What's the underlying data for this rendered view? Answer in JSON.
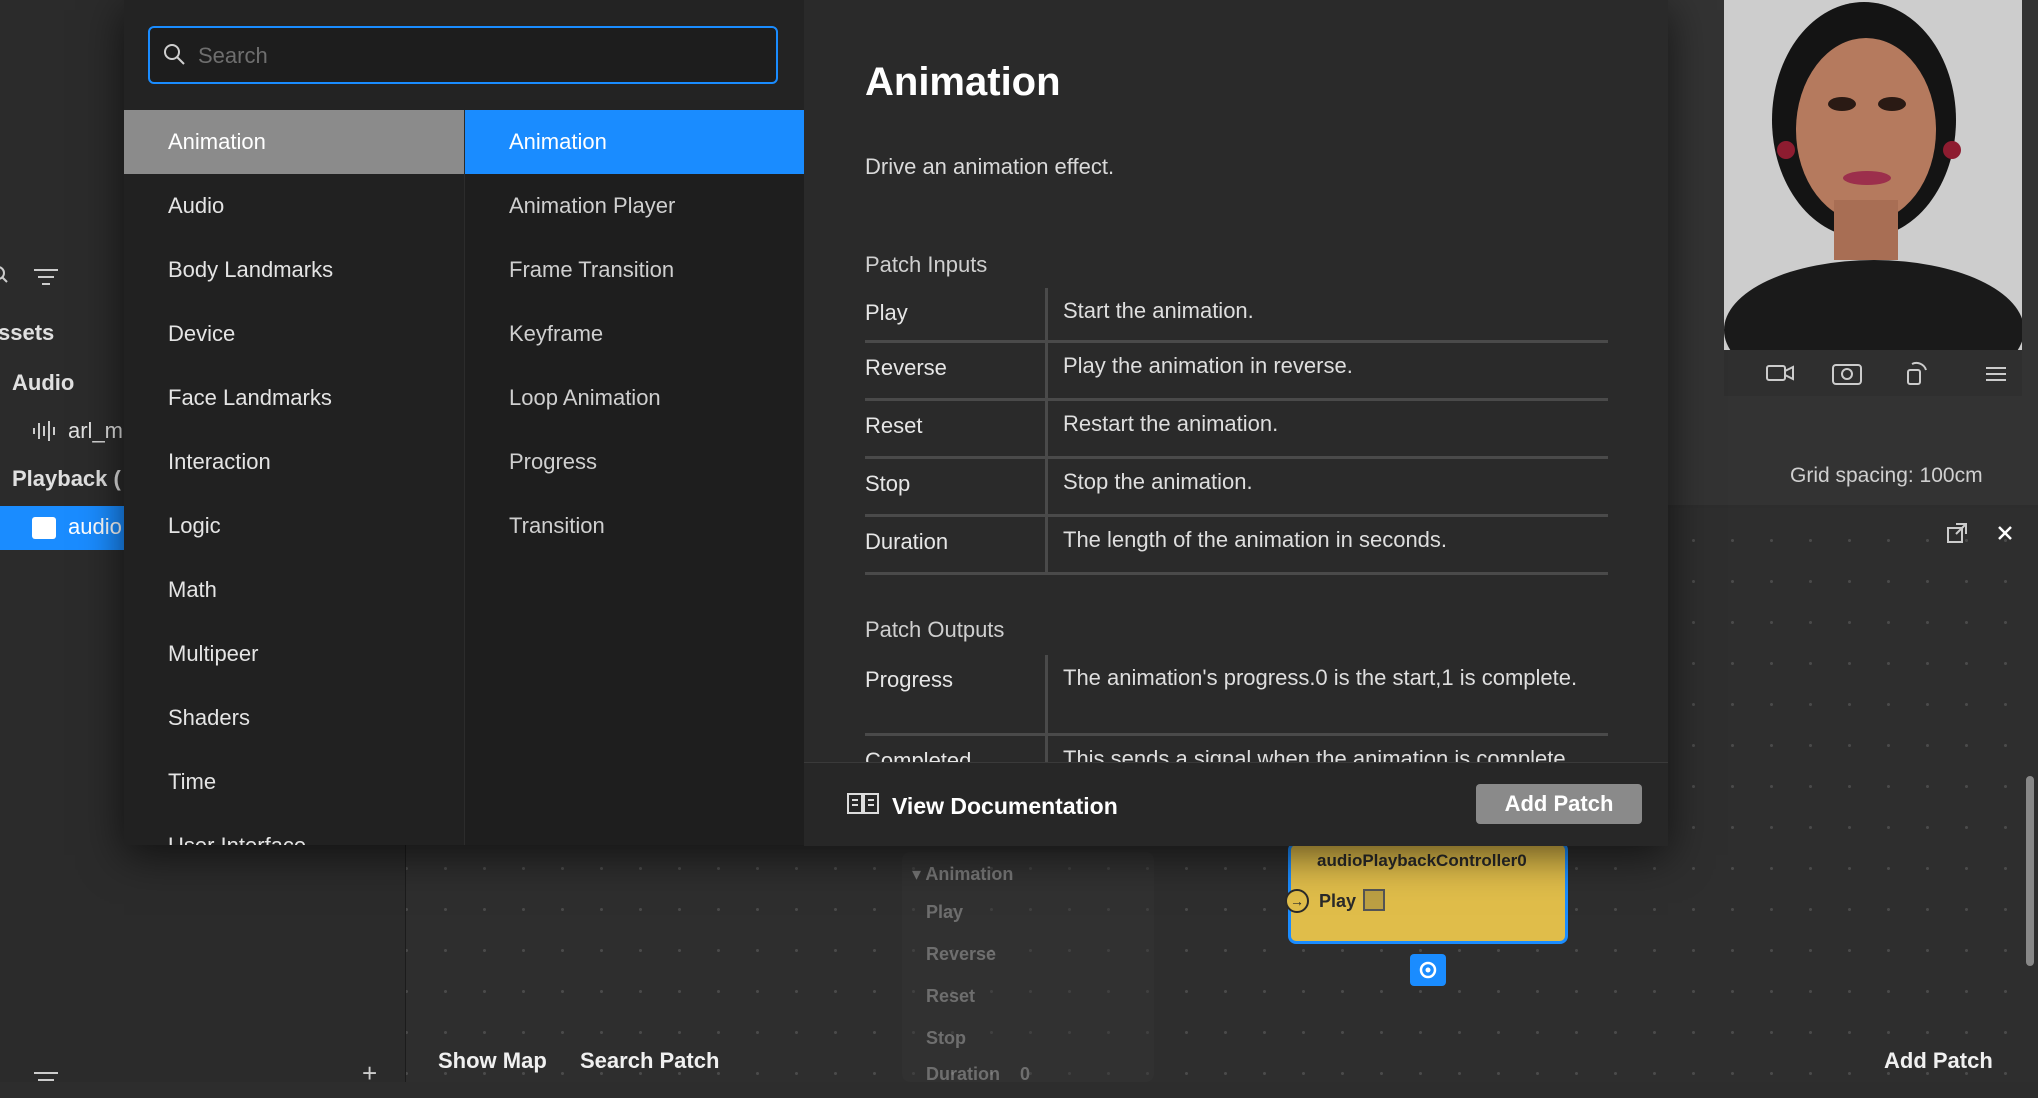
{
  "search": {
    "placeholder": "Search",
    "value": ""
  },
  "categories": [
    "Animation",
    "Audio",
    "Body Landmarks",
    "Device",
    "Face Landmarks",
    "Interaction",
    "Logic",
    "Math",
    "Multipeer",
    "Shaders",
    "Time",
    "User Interface"
  ],
  "selected_category": "Animation",
  "subcategories": [
    "Animation",
    "Animation Player",
    "Frame Transition",
    "Keyframe",
    "Loop Animation",
    "Progress",
    "Transition"
  ],
  "selected_subcategory": "Animation",
  "detail": {
    "title": "Animation",
    "description": "Drive an animation effect.",
    "inputs_heading": "Patch Inputs",
    "inputs": [
      {
        "name": "Play",
        "desc": "Start the animation."
      },
      {
        "name": "Reverse",
        "desc": "Play the animation in reverse."
      },
      {
        "name": "Reset",
        "desc": "Restart the animation."
      },
      {
        "name": "Stop",
        "desc": "Stop the animation."
      },
      {
        "name": "Duration",
        "desc": "The length of the animation in seconds."
      }
    ],
    "outputs_heading": "Patch Outputs",
    "outputs": [
      {
        "name": "Progress",
        "desc": "The animation's progress.0 is the start,1 is complete."
      },
      {
        "name": "Completed",
        "desc": "This sends a signal when the animation is complete."
      }
    ]
  },
  "footer": {
    "view_doc": "View Documentation",
    "add_patch": "Add Patch"
  },
  "background": {
    "assets_label": "ssets",
    "audio_label": "Audio",
    "audio_file": "arl_m",
    "playback_label": "Playback (",
    "audio_item": "audio",
    "grid_spacing": "Grid spacing: 100cm",
    "anim_node_title": "Animation",
    "anim_ports": [
      "Play",
      "Reverse",
      "Reset",
      "Stop",
      "Duration"
    ],
    "duration_value": "0",
    "controller_node_title": "audioPlaybackController0",
    "controller_port": "Play",
    "show_map": "Show Map",
    "search_patch": "Search Patch",
    "add_patch": "Add Patch"
  },
  "colors": {
    "accent": "#1a8cff",
    "node_yellow": "#e0bd4a",
    "selected_category": "#8b8b8b"
  }
}
